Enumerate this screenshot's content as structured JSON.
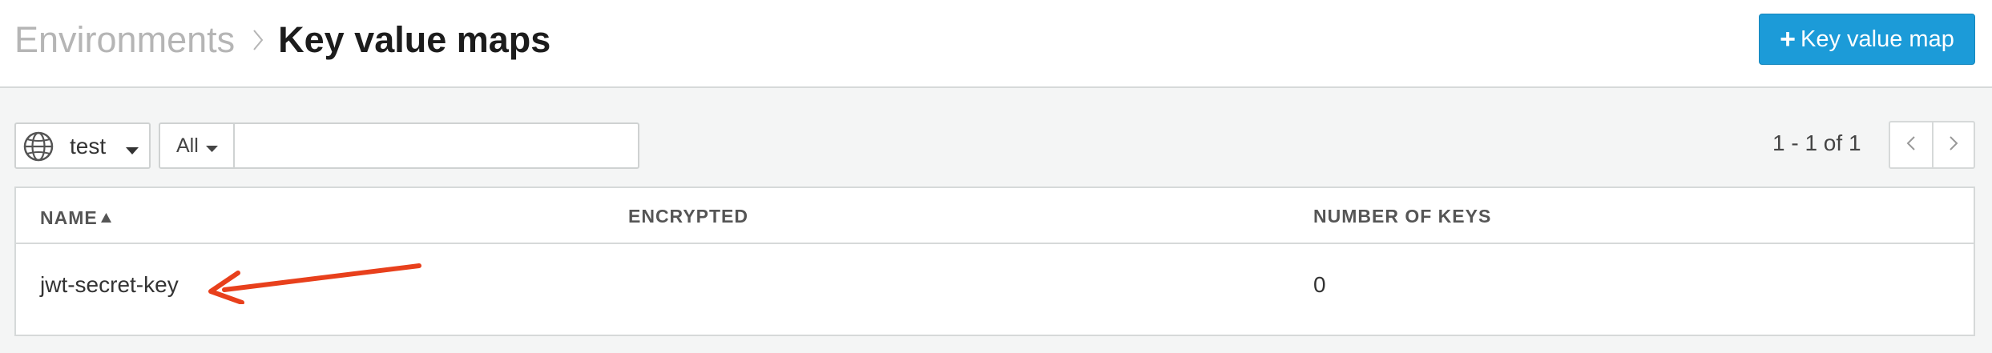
{
  "header": {
    "breadcrumb_parent": "Environments",
    "breadcrumb_current": "Key value maps",
    "add_button_label": "Key value map"
  },
  "filters": {
    "environment": "test",
    "type_filter": "All",
    "search_value": ""
  },
  "pagination": {
    "summary": "1 - 1 of 1"
  },
  "table": {
    "columns": [
      "NAME",
      "ENCRYPTED",
      "NUMBER OF KEYS"
    ],
    "sorted_by": "NAME",
    "sort_direction": "ascending",
    "rows": [
      {
        "name": "jwt-secret-key",
        "encrypted": "",
        "number_of_keys": "0"
      }
    ]
  },
  "annotation": {
    "arrow_color": "#e8401c",
    "points_to": "jwt-secret-key"
  },
  "colors": {
    "primary_button": "#1c9bd8",
    "page_background": "#f4f5f5",
    "border": "#d6d9d9"
  },
  "icons": [
    "chevron-right-icon",
    "plus-icon",
    "globe-icon",
    "caret-down-icon",
    "sort-asc-icon",
    "chevron-left-icon",
    "annotation-arrow-icon"
  ]
}
